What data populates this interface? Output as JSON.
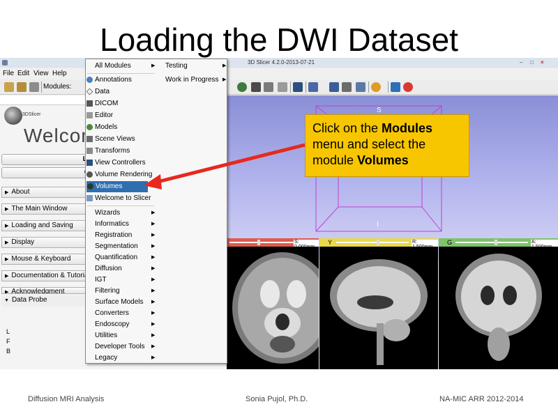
{
  "slide": {
    "title": "Loading the DWI Dataset"
  },
  "window": {
    "title": "3D Slicer 4.2.0-2013-07-21",
    "min": "–",
    "max": "□",
    "close": "×"
  },
  "menubar": {
    "file": "File",
    "edit": "Edit",
    "view": "View",
    "help": "Help"
  },
  "toolbar": {
    "modules_label": "Modules:"
  },
  "welcome": {
    "logo_text": "3DSlicer",
    "heading": "Welcom",
    "load_dicom": "Load DICOM Data",
    "customize": "Customize Slicer"
  },
  "sections": [
    {
      "label": "About"
    },
    {
      "label": "The Main Window"
    },
    {
      "label": "Loading and Saving"
    },
    {
      "label": "Display"
    },
    {
      "label": "Mouse & Keyboard"
    },
    {
      "label": "Documentation & Tutorials"
    },
    {
      "label": "Acknowledgment"
    }
  ],
  "data_probe": {
    "label": "Data Probe",
    "l": "L",
    "f": "F",
    "b": "B"
  },
  "view3d": {
    "s": "S",
    "i": "I"
  },
  "slices": {
    "red": {
      "readout": "S: 0.000mm"
    },
    "yellow": {
      "letter": "Y",
      "readout": "R: 1.500mm"
    },
    "green": {
      "letter": "G",
      "readout": "A: 1.500mm"
    }
  },
  "menu": {
    "items": [
      {
        "label": "All Modules",
        "submenu": "▶"
      },
      {
        "label": "Annotations"
      },
      {
        "label": "Data"
      },
      {
        "label": "DICOM"
      },
      {
        "label": "Editor"
      },
      {
        "label": "Models"
      },
      {
        "label": "Scene Views"
      },
      {
        "label": "Transforms"
      },
      {
        "label": "View Controllers"
      },
      {
        "label": "Volume Rendering"
      },
      {
        "label": "Volumes"
      },
      {
        "label": "Welcome to Slicer"
      },
      {
        "label": "Wizards",
        "submenu": "▶"
      },
      {
        "label": "Informatics",
        "submenu": "▶"
      },
      {
        "label": "Registration",
        "submenu": "▶"
      },
      {
        "label": "Segmentation",
        "submenu": "▶"
      },
      {
        "label": "Quantification",
        "submenu": "▶"
      },
      {
        "label": "Diffusion",
        "submenu": "▶"
      },
      {
        "label": "IGT",
        "submenu": "▶"
      },
      {
        "label": "Filtering",
        "submenu": "▶"
      },
      {
        "label": "Surface Models",
        "submenu": "▶"
      },
      {
        "label": "Converters",
        "submenu": "▶"
      },
      {
        "label": "Endoscopy",
        "submenu": "▶"
      },
      {
        "label": "Utilities",
        "submenu": "▶"
      },
      {
        "label": "Developer Tools",
        "submenu": "▶"
      },
      {
        "label": "Legacy",
        "submenu": "▶"
      }
    ],
    "right_col": [
      {
        "label": "Testing",
        "submenu": "▶"
      },
      {
        "label": "Work in Progress",
        "submenu": "▶"
      }
    ]
  },
  "callout": {
    "t1": "Click on the ",
    "t2": "Modules",
    "t3": "menu and select the",
    "t4": "module ",
    "t5": "Volumes"
  },
  "footer": {
    "left": "Diffusion MRI Analysis",
    "center": "Sonia Pujol, Ph.D.",
    "right": "NA-MIC ARR 2012-2014"
  },
  "colors": {
    "selected": "#2f6fb1",
    "callout": "#f7c600",
    "arrow": "#e8281e",
    "red_bar": "#e05a4e",
    "yellow_bar": "#e8d94a",
    "green_bar": "#7dc36a",
    "view_bg": "#9ea2e2"
  }
}
